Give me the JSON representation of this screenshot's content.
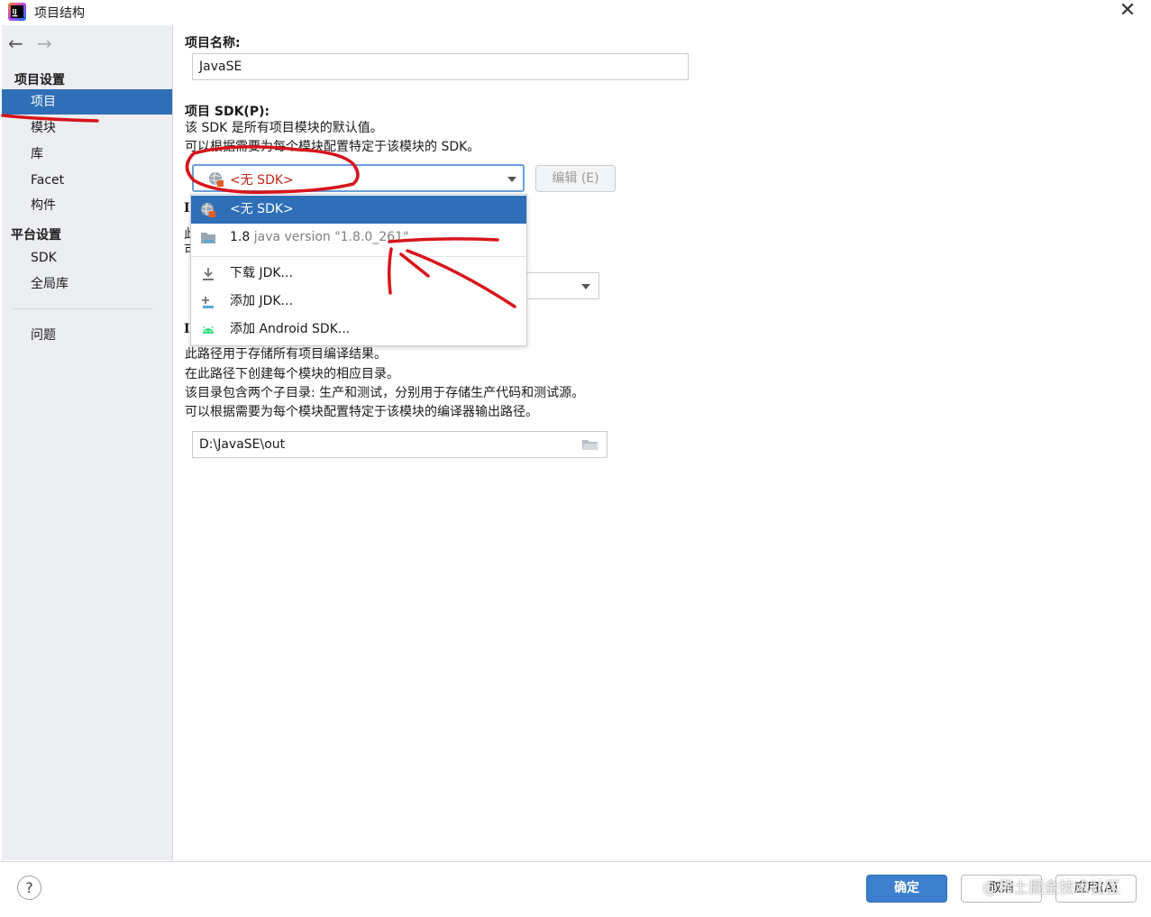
{
  "window": {
    "title": "项目结构",
    "close_glyph": "✕"
  },
  "sidebar": {
    "back_glyph": "←",
    "forward_glyph": "→",
    "project_settings_header": "项目设置",
    "items": [
      {
        "label": "项目",
        "selected": true
      },
      {
        "label": "模块"
      },
      {
        "label": "库"
      },
      {
        "label": "Facet"
      },
      {
        "label": "构件"
      }
    ],
    "platform_settings_header": "平台设置",
    "platform_items": [
      {
        "label": "SDK"
      },
      {
        "label": "全局库"
      }
    ],
    "problems": "问题"
  },
  "main": {
    "project_name_label": "项目名称:",
    "project_name_value": "JavaSE",
    "project_sdk_label": "项目 SDK(P):",
    "sdk_desc_1": "该 SDK 是所有项目模块的默认值。",
    "sdk_desc_2": "可以根据需要为每个模块配置特定于该模块的 SDK。",
    "sdk_selected": "<无 SDK>",
    "edit_button": "编辑 (E)",
    "hidden_label_1": "I",
    "hidden_text_1": "此",
    "hidden_text_2": "可",
    "hidden_label_2": "I",
    "output_desc_1": "此路径用于存储所有项目编译结果。",
    "output_desc_2": "在此路径下创建每个模块的相应目录。",
    "output_desc_3": "该目录包含两个子目录: 生产和测试，分别用于存储生产代码和测试源。",
    "output_desc_4": "可以根据需要为每个模块配置特定于该模块的编译器输出路径。",
    "output_path": "D:\\JavaSE\\out"
  },
  "dropdown": {
    "items": [
      {
        "label": "<无 SDK>",
        "icon": "globe-sdk-icon",
        "selected": true
      },
      {
        "label": "1.8",
        "sub": "java version \"1.8.0_261\"",
        "icon": "jdk-folder-icon"
      },
      {
        "label": "下载 JDK...",
        "icon": "download-icon"
      },
      {
        "label": "添加 JDK...",
        "icon": "add-jdk-icon"
      },
      {
        "label": "添加 Android SDK...",
        "icon": "android-icon"
      }
    ]
  },
  "footer": {
    "help": "?",
    "ok": "确定",
    "cancel": "取消",
    "apply": "应用(A)",
    "watermark": "@稀土掘金技术社区"
  },
  "colors": {
    "selection": "#2f6fb8",
    "annotation_red": "#d8141b",
    "no_sdk_text": "#c4271c"
  }
}
